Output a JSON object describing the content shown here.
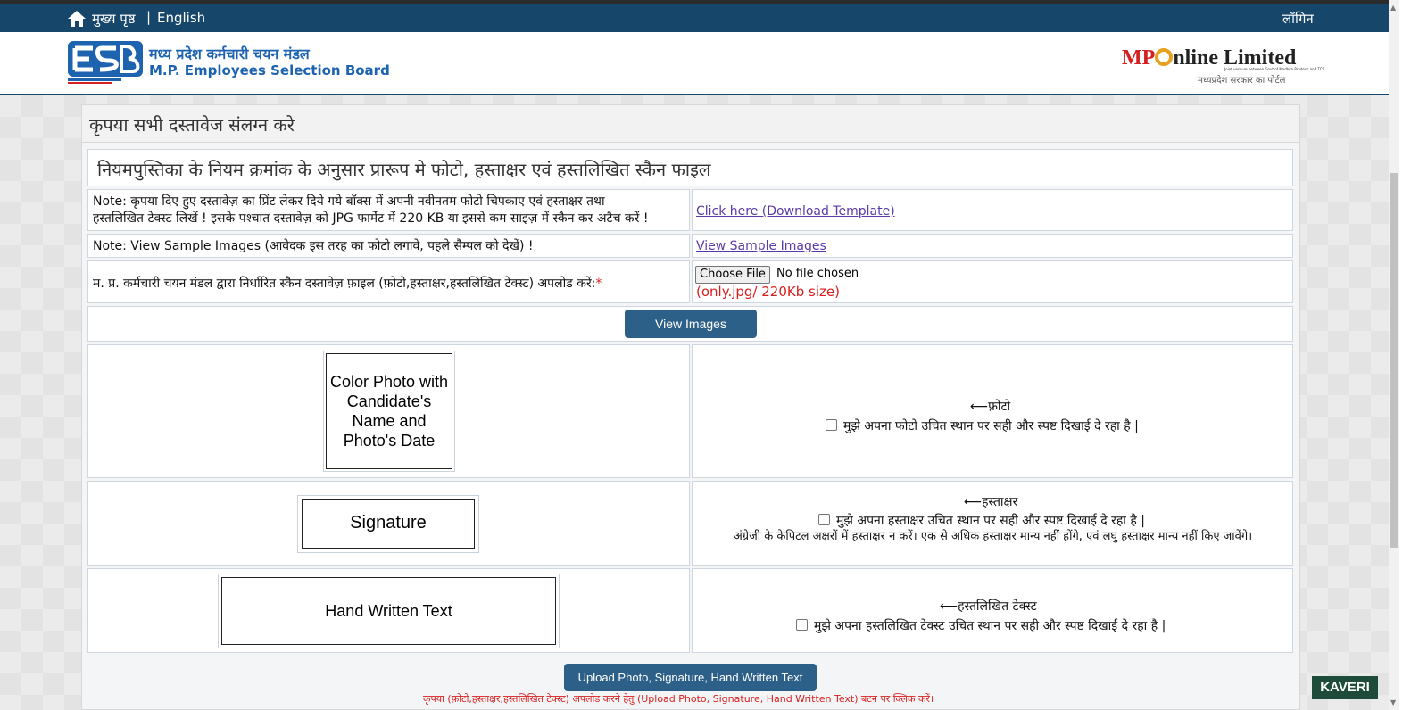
{
  "topbar": {
    "home_label": "मुख्य पृष्ठ",
    "separator": "|",
    "english_label": "English",
    "login_label": "लॉगिन"
  },
  "header": {
    "org_name_hindi": "मध्य प्रदेश कर्मचारी चयन मंडल",
    "org_name_english": "M.P. Employees Selection Board",
    "partner_name_prefix": "MP",
    "partner_name_suffix": "nline Limited",
    "partner_tagline": "Joint venture between Govt of Madhya Pradesh and TCS",
    "partner_subtitle": "मध्यप्रदेश सरकार का पोर्टल",
    "colors": {
      "topbar": "#17466b",
      "brand_blue": "#1d63b0",
      "brand_red": "#d32020"
    }
  },
  "main": {
    "panel_title": "कृपया सभी दस्तावेज संलग्न करे",
    "subtitle": "नियमपुस्तिका के नियम क्रमांक के अनुसार प्रारूप मे फोटो, हस्ताक्षर एवं हस्तलिखित स्कैन फाइल",
    "note1_line1": "Note: कृपया दिए हुए दस्तावेज़ का प्रिंट लेकर दिये गये बॉक्स में अपनी नवीनतम फोटो चिपकाए एवं हस्ताक्षर तथा",
    "note1_line2": "हस्तलिखित टेक्स्ट लिखें ! इसके पश्चात दस्तावेज़ को JPG फार्मेट में 220 KB या इससे कम साइज़ में स्कैन कर अटैच करें !",
    "download_link": "Click here (Download Template)",
    "note2": "Note: View Sample Images (आवेदक इस तरह का फोटो लगावे, पहले सैम्पल को देखें) !",
    "sample_link": "View Sample Images",
    "upload_label": "म. प्र. कर्मचारी चयन मंडल द्वारा निर्धारित स्कैन दस्तावेज़ फ़ाइल (फ़ोटो,हस्ताक्षर,हस्तलिखित टेक्स्ट) अपलोड करें:",
    "required_mark": "*",
    "choose_file": "Choose File",
    "no_file": "No file chosen",
    "size_note": "(only.jpg/ 220Kb size)",
    "view_images_button": "View Images",
    "photo_sample_text": "Color Photo with Candidate's Name and Photo's Date",
    "photo_arrow": "⟵फ़ोटो",
    "photo_check": "मुझे अपना फोटो उचित स्थान पर सही और स्पष्ट दिखाई दे रहा है |",
    "signature_sample_text": "Signature",
    "signature_arrow": "⟵हस्ताक्षर",
    "signature_check": "मुझे अपना हस्ताक्षर उचित स्थान पर सही और स्पष्ट दिखाई दे रहा है |",
    "signature_warning": "अंग्रेजी के केपिटल अक्षरों में हस्ताक्षर न करें। एक से अधिक हस्ताक्षर मान्य नहीं होंगे, एवं लघु हस्ताक्षर मान्य नहीं किए जावेंगे।",
    "handwritten_sample_text": "Hand Written Text",
    "handwritten_arrow": "⟵हस्तलिखित टेक्स्ट",
    "handwritten_check": "मुझे अपना हस्तलिखित टेक्स्ट उचित स्थान पर सही और स्पष्ट दिखाई दे रहा है |",
    "upload_button": "Upload Photo, Signature, Hand Written Text",
    "bottom_note": "कृपया (फ़ोटो,हस्ताक्षर,हस्तलिखित टेक्स्ट) अपलोड करने हेतु (Upload Photo, Signature, Hand Written Text) बटन पर क्लिक करें।"
  },
  "badge": {
    "label": "KAVERI"
  }
}
